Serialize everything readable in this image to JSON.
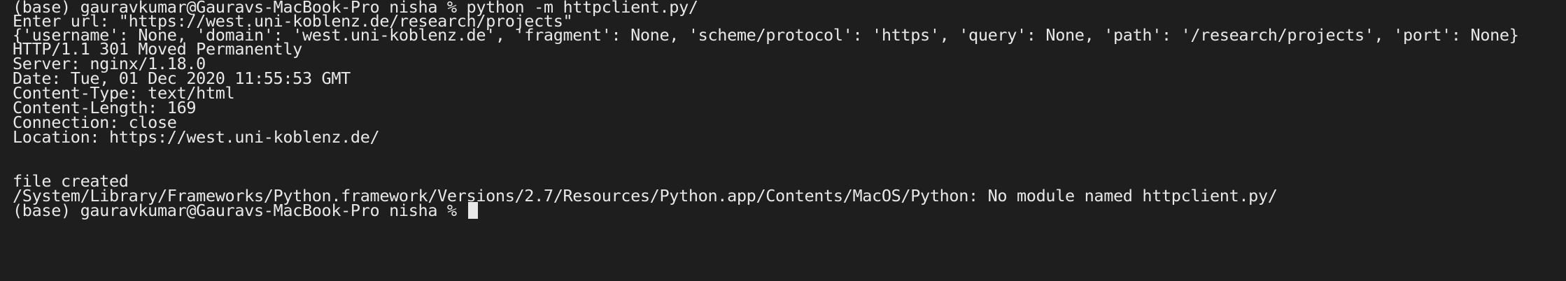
{
  "terminal": {
    "lines": [
      "(base) gauravkumar@Gauravs-MacBook-Pro nisha % python -m httpclient.py/",
      "Enter url: \"https://west.uni-koblenz.de/research/projects\"",
      "{'username': None, 'domain': 'west.uni-koblenz.de', 'fragment': None, 'scheme/protocol': 'https', 'query': None, 'path': '/research/projects', 'port': None}",
      "HTTP/1.1 301 Moved Permanently",
      "Server: nginx/1.18.0",
      "Date: Tue, 01 Dec 2020 11:55:53 GMT",
      "Content-Type: text/html",
      "Content-Length: 169",
      "Connection: close",
      "Location: https://west.uni-koblenz.de/",
      "",
      "",
      "file created",
      "/System/Library/Frameworks/Python.framework/Versions/2.7/Resources/Python.app/Contents/MacOS/Python: No module named httpclient.py/",
      "(base) gauravkumar@Gauravs-MacBook-Pro nisha % "
    ]
  },
  "colors": {
    "background": "#1e1e1e",
    "text": "#e8e8e8"
  }
}
